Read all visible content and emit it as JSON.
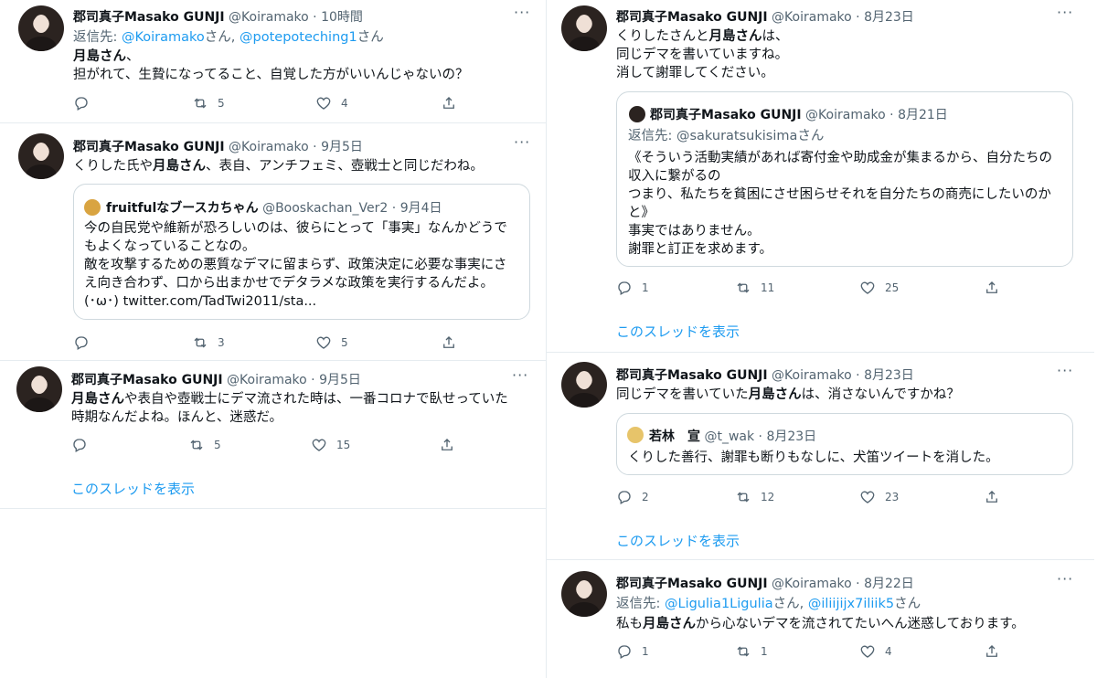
{
  "colors": {
    "link": "#1d9bf0",
    "secondary": "#536471",
    "border": "#cfd9de"
  },
  "tweets": [
    {
      "name": "郡司真子Masako GUNJI",
      "handle": "@Koiramako",
      "time": "10時間",
      "reply_prefix": "返信先: ",
      "reply_user1": "@Koiramako",
      "reply_mid": "さん, ",
      "reply_user2": "@potepoteching1",
      "reply_suffix": "さん",
      "line1_bold": "月島さん",
      "line1_rest": "、",
      "line2": "担がれて、生贄になってること、自覚した方がいいんじゃないの？",
      "retweets": "5",
      "likes": "4"
    },
    {
      "name": "郡司真子Masako GUNJI",
      "handle": "@Koiramako",
      "time": "9月5日",
      "text_pre": "くりした氏や",
      "text_bold": "月島さん",
      "text_post": "、表自、アンチフェミ、壺戦士と同じだわね。",
      "quote": {
        "name": "fruitfulなブースカちゃん",
        "handle": "@Booskachan_Ver2",
        "time": "9月4日",
        "lines": [
          "今の自民党や維新が恐ろしいのは、彼らにとって「事実」なんかどうで",
          "もよくなっていることなの。",
          "敵を攻撃するための悪質なデマに留まらず、政策決定に必要な事実にさ",
          "え向き合わず、口から出まかせでデタラメな政策を実行するんだよ。",
          "(･ω･) twitter.com/TadTwi2011/sta..."
        ]
      },
      "retweets": "3",
      "likes": "5"
    },
    {
      "name": "郡司真子Masako GUNJI",
      "handle": "@Koiramako",
      "time": "9月5日",
      "line1_bold": "月島さん",
      "line1_rest": "や表自や壺戦士にデマ流された時は、一番コロナで臥せっていた",
      "line2": "時期なんだよね。ほんと、迷惑だ。",
      "retweets": "5",
      "likes": "15",
      "thread": "このスレッドを表示"
    },
    {
      "name": "郡司真子Masako GUNJI",
      "handle": "@Koiramako",
      "time": "8月23日",
      "line1_pre": "くりしたさんと",
      "line1_bold": "月島さん",
      "line1_post": "は、",
      "line2": "同じデマを書いていますね。",
      "line3": "消して謝罪してください。",
      "quote": {
        "name": "郡司真子Masako GUNJI",
        "handle": "@Koiramako",
        "time": "8月21日",
        "reply": "返信先: @sakuratsukisimaさん",
        "lines": [
          "《そういう活動実績があれば寄付金や助成金が集まるから、自分たちの",
          "収入に繋がるの",
          "つまり、私たちを貧困にさせ困らせそれを自分たちの商売にしたいのか",
          "と》",
          "事実ではありません。",
          "謝罪と訂正を求めます。"
        ]
      },
      "replies": "1",
      "retweets": "11",
      "likes": "25",
      "thread": "このスレッドを表示"
    },
    {
      "name": "郡司真子Masako GUNJI",
      "handle": "@Koiramako",
      "time": "8月23日",
      "text_pre": "同じデマを書いていた",
      "text_bold": "月島さん",
      "text_post": "は、消さないんですかね？",
      "quote": {
        "name": "若林　宣",
        "handle": "@t_wak",
        "time": "8月23日",
        "text": "くりした善行、謝罪も断りもなしに、犬笛ツイートを消した。"
      },
      "replies": "2",
      "retweets": "12",
      "likes": "23",
      "thread": "このスレッドを表示"
    },
    {
      "name": "郡司真子Masako GUNJI",
      "handle": "@Koiramako",
      "time": "8月22日",
      "reply_prefix": "返信先: ",
      "reply_user1": "@Ligulia1Ligulia",
      "reply_mid": "さん, ",
      "reply_user2": "@iliijijx7iliik5",
      "reply_suffix": "さん",
      "text_pre": "私も",
      "text_bold": "月島さん",
      "text_post": "から心ないデマを流されてたいへん迷惑しております。",
      "replies": "1",
      "retweets": "1",
      "likes": "4"
    }
  ],
  "dot": "·",
  "more_glyph": "···"
}
